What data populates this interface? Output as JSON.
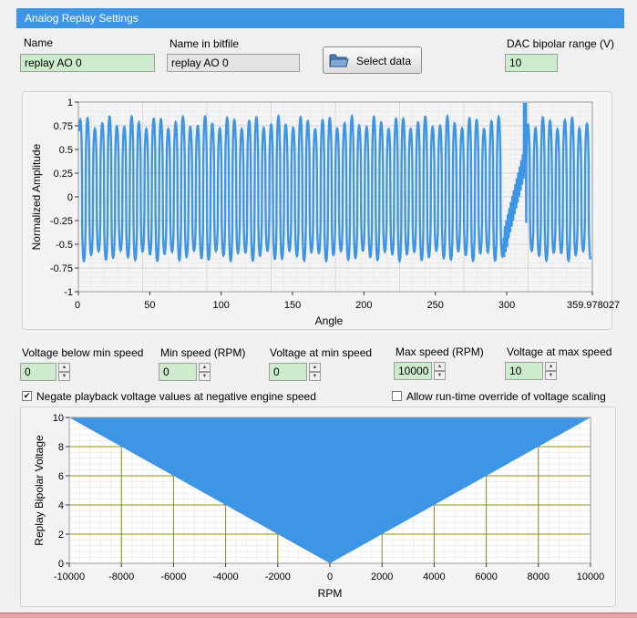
{
  "window": {
    "title": "Analog Replay Settings"
  },
  "name": {
    "label": "Name",
    "value": "replay AO 0"
  },
  "bitfile_name": {
    "label": "Name in bitfile",
    "value": "replay AO 0"
  },
  "select_data": {
    "label": "Select data"
  },
  "dac": {
    "label": "DAC bipolar range (V)",
    "value": "10"
  },
  "controls": {
    "v_below_min": {
      "label": "Voltage below min speed",
      "value": "0"
    },
    "min_speed": {
      "label": "Min speed (RPM)",
      "value": "0"
    },
    "v_at_min": {
      "label": "Voltage at min speed",
      "value": "0"
    },
    "max_speed": {
      "label": "Max speed (RPM)",
      "value": "10000"
    },
    "v_at_max": {
      "label": "Voltage at max speed",
      "value": "10"
    }
  },
  "checkboxes": {
    "negate": {
      "label": "Negate playback voltage values at negative engine speed",
      "checked": true
    },
    "override": {
      "label": "Allow run-time override of voltage scaling",
      "checked": false
    }
  },
  "colors": {
    "accent": "#3d95e6",
    "series": "#3d95e6",
    "control_bg": "#cdeccd",
    "grid_major": "#8c8c1c"
  },
  "chart_data": [
    {
      "type": "line",
      "xlabel": "Angle",
      "ylabel": "Normalized Amplitude",
      "xlim": [
        0,
        359.978027
      ],
      "ylim": [
        -1,
        1
      ],
      "x_ticks": [
        "0",
        "50",
        "100",
        "150",
        "200",
        "250",
        "300",
        "359.978027"
      ],
      "y_ticks": [
        "1",
        "0.75",
        "0.5",
        "0.25",
        "0",
        "-0.25",
        "-0.5",
        "-0.75",
        "-1"
      ],
      "grid": true,
      "series": [
        {
          "cycles": 70,
          "peak_max_approx": 0.85,
          "peak_min_approx": -0.75,
          "anomaly_x_approx": [
            298,
            312
          ]
        }
      ]
    },
    {
      "type": "area",
      "xlabel": "RPM",
      "ylabel": "Replay Bipolar Voltage",
      "xlim": [
        -10000,
        10000
      ],
      "ylim": [
        0,
        10
      ],
      "x_ticks": [
        "-10000",
        "-8000",
        "-6000",
        "-4000",
        "-2000",
        "0",
        "2000",
        "4000",
        "6000",
        "8000",
        "10000"
      ],
      "y_ticks": [
        "10",
        "8",
        "6",
        "4",
        "2",
        "0"
      ],
      "grid": true,
      "series": [
        {
          "x": [
            -10000,
            0,
            10000
          ],
          "y": [
            10,
            0,
            10
          ]
        }
      ]
    }
  ]
}
